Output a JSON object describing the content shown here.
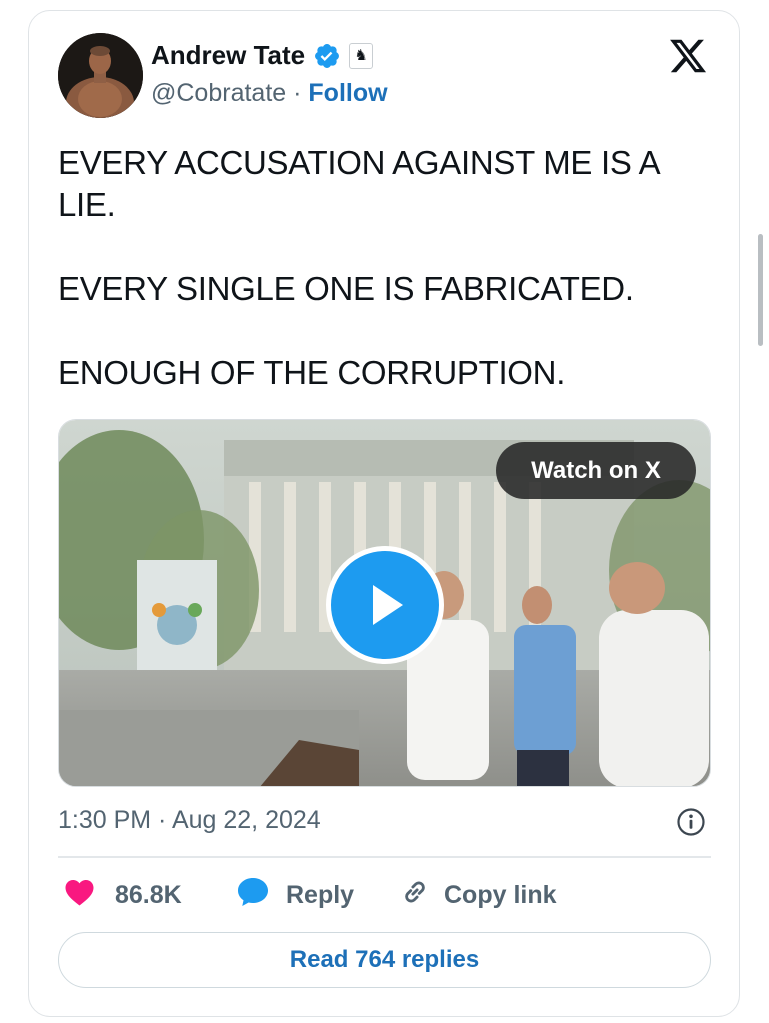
{
  "author": {
    "name": "Andrew Tate",
    "handle": "@Cobratate",
    "separator": "·",
    "follow_label": "Follow",
    "verified_icon": "verified-badge-icon",
    "affiliate_icon": "chess-knight-icon",
    "affiliate_glyph": "♞"
  },
  "platform_logo": "x-logo-icon",
  "tweet": {
    "lines": [
      "EVERY ACCUSATION AGAINST ME IS A LIE.",
      "EVERY SINGLE ONE IS FABRICATED.",
      "ENOUGH OF THE CORRUPTION."
    ]
  },
  "media": {
    "watch_label": "Watch on X",
    "play_icon": "play-icon"
  },
  "meta": {
    "timestamp": "1:30 PM · Aug 22, 2024",
    "info_icon": "info-icon"
  },
  "actions": {
    "like_count": "86.8K",
    "reply_label": "Reply",
    "copy_link_label": "Copy link"
  },
  "read_replies_label": "Read 764 replies",
  "colors": {
    "accent_blue": "#1d9bf0",
    "link_blue": "#1d70b8",
    "like_pink": "#f91880",
    "muted_text": "#536471"
  }
}
